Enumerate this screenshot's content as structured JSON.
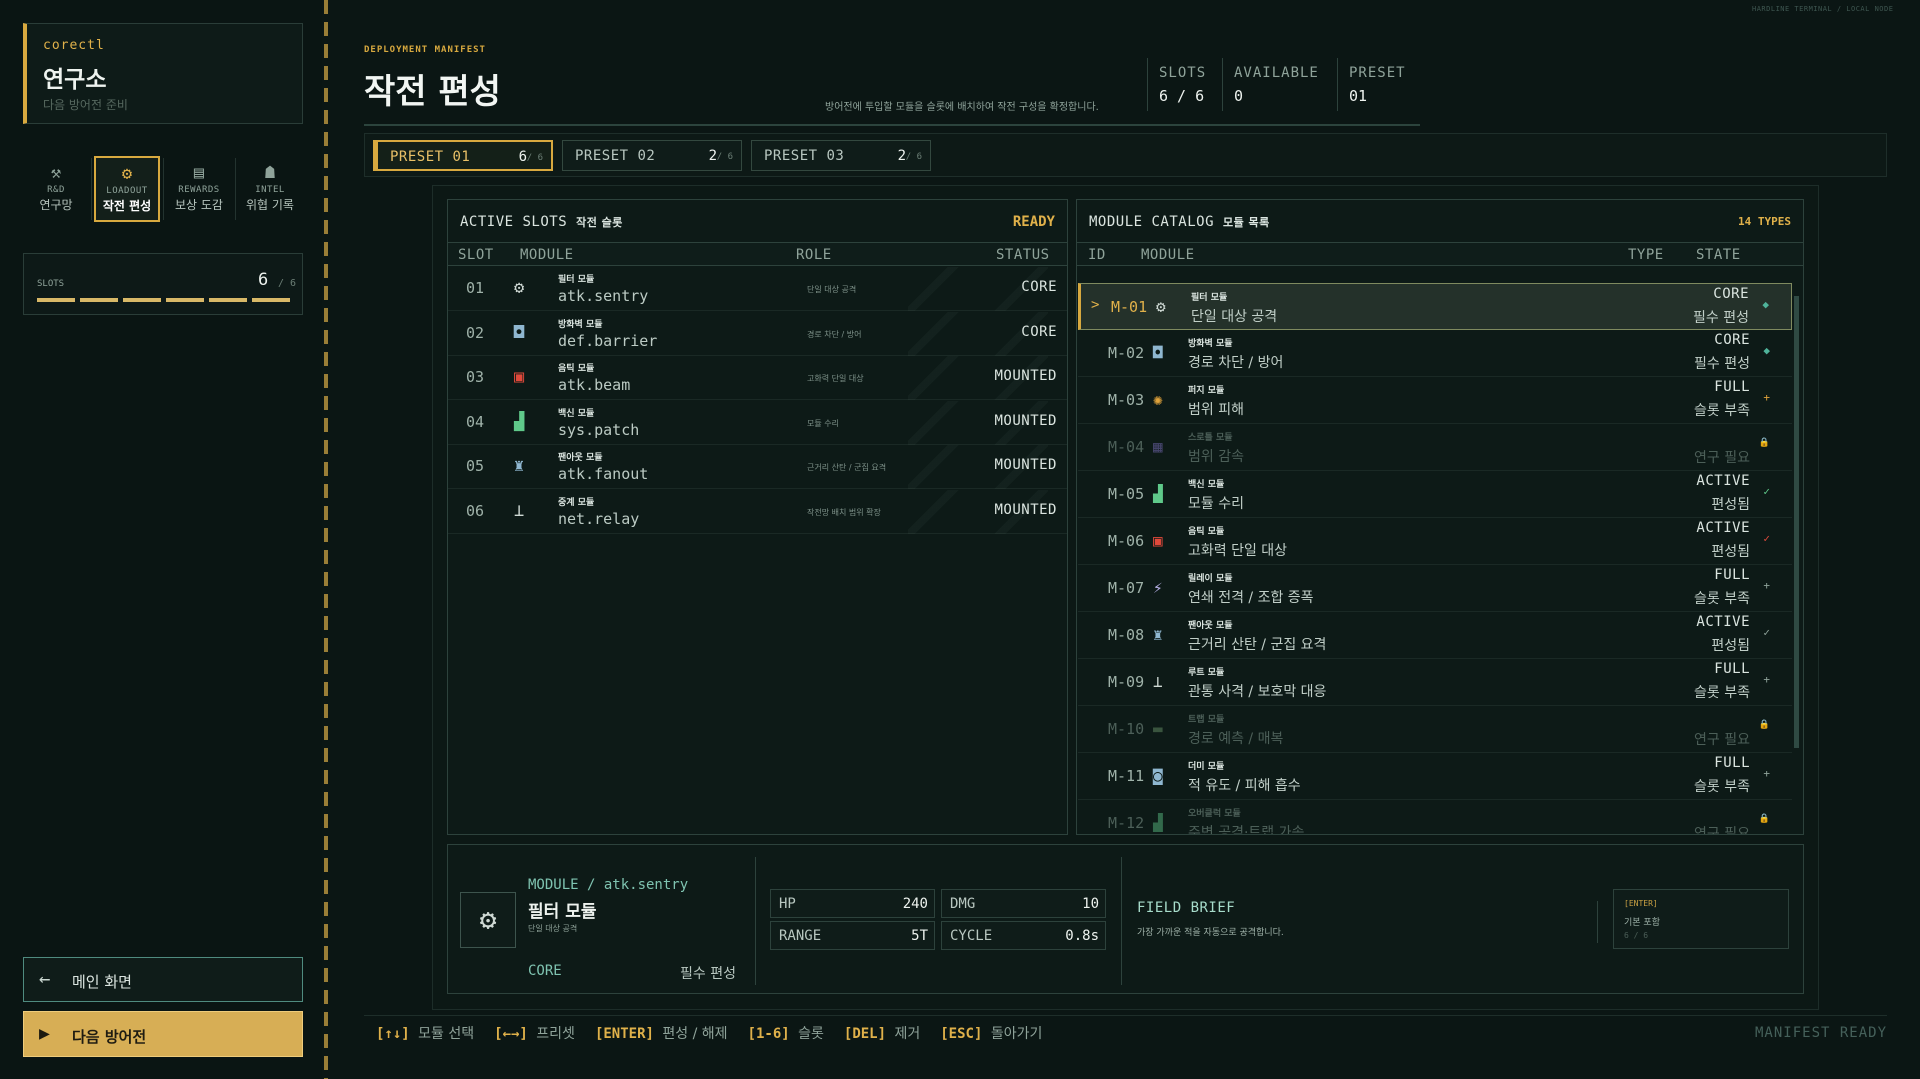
{
  "corner": "HARDLINE TERMINAL / LOCAL NODE",
  "brand": {
    "user": "corectl",
    "title": "연구소",
    "subtitle": "다음 방어전 준비"
  },
  "nav": [
    {
      "icon": "⚒",
      "en": "R&D",
      "kr": "연구망"
    },
    {
      "icon": "⚙",
      "en": "LOADOUT",
      "kr": "작전 편성"
    },
    {
      "icon": "▤",
      "en": "REWARDS",
      "kr": "보상 도감"
    },
    {
      "icon": "☗",
      "en": "INTEL",
      "kr": "위협 기록"
    }
  ],
  "slots": {
    "label": "SLOTS",
    "count": "6",
    "max": "/ 6",
    "filled": 6
  },
  "buttons": {
    "main_icon": "←",
    "main": "메인 화면",
    "next_icon": "▶",
    "next": "다음 방어전"
  },
  "header": {
    "tag": "DEPLOYMENT MANIFEST",
    "title": "작전 편성",
    "subtitle": "방어전에 투입할 모듈을 슬롯에 배치하여 작전 구성을 확정합니다.",
    "stats": [
      {
        "k": "SLOTS",
        "v": "6 / 6"
      },
      {
        "k": "AVAILABLE",
        "v": "0"
      },
      {
        "k": "PRESET",
        "v": "01"
      }
    ]
  },
  "presets": [
    {
      "name": "PRESET 01",
      "count": "6",
      "max": "/ 6"
    },
    {
      "name": "PRESET 02",
      "count": "2",
      "max": "/ 6"
    },
    {
      "name": "PRESET 03",
      "count": "2",
      "max": "/ 6"
    }
  ],
  "active": {
    "title": "ACTIVE SLOTS",
    "title_kr": "작전 슬롯",
    "status": "READY",
    "cols": {
      "slot": "SLOT",
      "module": "MODULE",
      "role": "ROLE",
      "status": "STATUS"
    },
    "rows": [
      {
        "no": "01",
        "icon": "⚙",
        "icon_color": "#cfd9d4",
        "kn": "필터 모듈",
        "en": "atk.sentry",
        "role": "단일 대상 공격",
        "status": "CORE"
      },
      {
        "no": "02",
        "icon": "◘",
        "icon_color": "#8fb7d0",
        "kn": "방화벽 모듈",
        "en": "def.barrier",
        "role": "경로 차단 / 방어",
        "status": "CORE"
      },
      {
        "no": "03",
        "icon": "▣",
        "icon_color": "#e0493b",
        "kn": "음틱 모듈",
        "en": "atk.beam",
        "role": "고화력 단일 대상",
        "status": "MOUNTED"
      },
      {
        "no": "04",
        "icon": "▟",
        "icon_color": "#5fc98a",
        "kn": "백신 모듈",
        "en": "sys.patch",
        "role": "모듈 수리",
        "status": "MOUNTED"
      },
      {
        "no": "05",
        "icon": "♜",
        "icon_color": "#8fb7d0",
        "kn": "팬아웃 모듈",
        "en": "atk.fanout",
        "role": "근거리 산탄 / 군집 요격",
        "status": "MOUNTED"
      },
      {
        "no": "06",
        "icon": "⊥",
        "icon_color": "#cfd9d4",
        "kn": "중계 모듈",
        "en": "net.relay",
        "role": "작전망 배치 범위 확장",
        "status": "MOUNTED"
      }
    ]
  },
  "catalog": {
    "title": "MODULE CATALOG",
    "title_kr": "모듈 목록",
    "count": "14 TYPES",
    "cols": {
      "id": "ID",
      "module": "MODULE",
      "type": "TYPE",
      "state": "STATE"
    },
    "selected_marker": ">",
    "rows": [
      {
        "id": "M-01",
        "icon": "⚙",
        "icon_color": "#cfd9d4",
        "kn": "필터 모듈",
        "desc": "단일 대상 공격",
        "type": "CORE",
        "state": "필수 편성",
        "mark": "◆",
        "mark_color": "#4fb39a",
        "locked": false,
        "selected": true
      },
      {
        "id": "M-02",
        "icon": "◘",
        "icon_color": "#8fb7d0",
        "kn": "방화벽 모듈",
        "desc": "경로 차단 / 방어",
        "type": "CORE",
        "state": "필수 편성",
        "mark": "◆",
        "mark_color": "#4fb39a",
        "locked": false,
        "selected": false
      },
      {
        "id": "M-03",
        "icon": "✺",
        "icon_color": "#e0a33b",
        "kn": "퍼지 모듈",
        "desc": "범위 피해",
        "type": "FULL",
        "state": "슬롯 부족",
        "mark": "+",
        "mark_color": "#e0a33b",
        "locked": false,
        "selected": false
      },
      {
        "id": "M-04",
        "icon": "▦",
        "icon_color": "#8b7bd6",
        "kn": "스로틀 모듈",
        "desc": "범위 감속",
        "type": "",
        "state": "연구 필요",
        "mark": "🔒",
        "mark_color": "#4c5f58",
        "locked": true,
        "selected": false
      },
      {
        "id": "M-05",
        "icon": "▟",
        "icon_color": "#5fc98a",
        "kn": "백신 모듈",
        "desc": "모듈 수리",
        "type": "ACTIVE",
        "state": "편성됨",
        "mark": "✓",
        "mark_color": "#5fc98a",
        "locked": false,
        "selected": false
      },
      {
        "id": "M-06",
        "icon": "▣",
        "icon_color": "#e0493b",
        "kn": "음틱 모듈",
        "desc": "고화력 단일 대상",
        "type": "ACTIVE",
        "state": "편성됨",
        "mark": "✓",
        "mark_color": "#e0493b",
        "locked": false,
        "selected": false
      },
      {
        "id": "M-07",
        "icon": "⚡",
        "icon_color": "#b9b2e8",
        "kn": "릴레이 모듈",
        "desc": "연쇄 전격 / 조합 증폭",
        "type": "FULL",
        "state": "슬롯 부족",
        "mark": "+",
        "mark_color": "#8fa39a",
        "locked": false,
        "selected": false
      },
      {
        "id": "M-08",
        "icon": "♜",
        "icon_color": "#8fb7d0",
        "kn": "팬아웃 모듈",
        "desc": "근거리 산탄 / 군집 요격",
        "type": "ACTIVE",
        "state": "편성됨",
        "mark": "✓",
        "mark_color": "#8fa39a",
        "locked": false,
        "selected": false
      },
      {
        "id": "M-09",
        "icon": "⊥",
        "icon_color": "#cfd9d4",
        "kn": "루트 모듈",
        "desc": "관통 사격 / 보호막 대응",
        "type": "FULL",
        "state": "슬롯 부족",
        "mark": "+",
        "mark_color": "#8fa39a",
        "locked": false,
        "selected": false
      },
      {
        "id": "M-10",
        "icon": "▬",
        "icon_color": "#6f9a6f",
        "kn": "트랩 모듈",
        "desc": "경로 예측 / 매복",
        "type": "",
        "state": "연구 필요",
        "mark": "🔒",
        "mark_color": "#4c5f58",
        "locked": true,
        "selected": false
      },
      {
        "id": "M-11",
        "icon": "◙",
        "icon_color": "#8fb7d0",
        "kn": "더미 모듈",
        "desc": "적 유도 / 피해 흡수",
        "type": "FULL",
        "state": "슬롯 부족",
        "mark": "+",
        "mark_color": "#8fa39a",
        "locked": false,
        "selected": false
      },
      {
        "id": "M-12",
        "icon": "▟",
        "icon_color": "#5fc98a",
        "kn": "오버클럭 모듈",
        "desc": "주변 공격·트랩 가속",
        "type": "",
        "state": "연구 필요",
        "mark": "🔒",
        "mark_color": "#4c5f58",
        "locked": true,
        "selected": false
      }
    ]
  },
  "detail": {
    "icon": "⚙",
    "path": "MODULE / atk.sentry",
    "name": "필터 모듈",
    "role": "단일 대상 공격",
    "type": "CORE",
    "state": "필수 편성",
    "stats": [
      {
        "k": "HP",
        "v": "240"
      },
      {
        "k": "DMG",
        "v": "10"
      },
      {
        "k": "RANGE",
        "v": "5T"
      },
      {
        "k": "CYCLE",
        "v": "0.8s"
      }
    ],
    "brief_title": "FIELD BRIEF",
    "brief": "가장 가까운 적을 자동으로 공격합니다.",
    "enter_key": "[ENTER]",
    "enter_label": "기본 포함",
    "enter_count": "6 / 6"
  },
  "hints": [
    {
      "key": "[↑↓]",
      "label": "모듈 선택"
    },
    {
      "key": "[←→]",
      "label": "프리셋"
    },
    {
      "key": "[ENTER]",
      "label": "편성 / 해제"
    },
    {
      "key": "[1-6]",
      "label": "슬롯"
    },
    {
      "key": "[DEL]",
      "label": "제거"
    },
    {
      "key": "[ESC]",
      "label": "돌아가기"
    }
  ],
  "footer_status": "MANIFEST READY",
  "colors": {
    "accent": "#d8a93f",
    "panel": "#0d1a17",
    "bg": "#0b1614"
  }
}
